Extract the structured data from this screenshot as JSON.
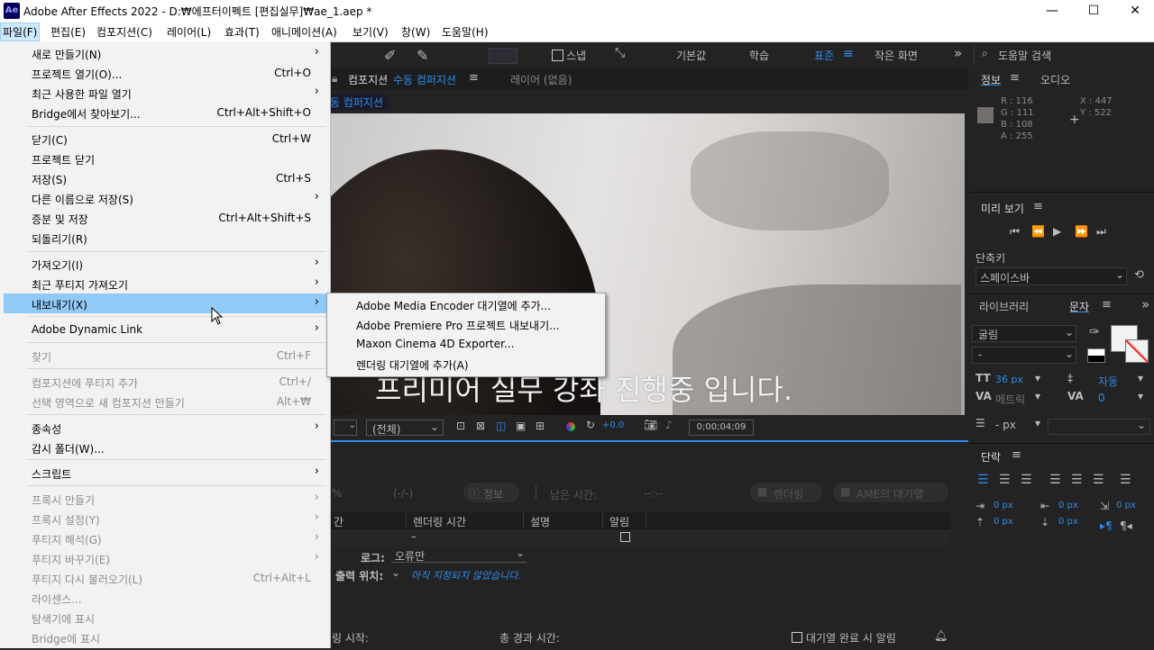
{
  "window": {
    "app_icon": "Ae",
    "title": "Adobe After Effects 2022 - D:₩에프터이펙트 [편집실무]₩ae_1.aep *",
    "minimize": "—",
    "maximize": "☐",
    "close": "✕"
  },
  "menubar": [
    "파일(F)",
    "편집(E)",
    "컴포지션(C)",
    "레이어(L)",
    "효과(T)",
    "애니메이션(A)",
    "보기(V)",
    "창(W)",
    "도움말(H)"
  ],
  "toolbar": {
    "snap": "스냅",
    "workspaces": [
      "기본값",
      "학습",
      "표준",
      "작은 화면"
    ],
    "workspace_menu": "≡",
    "overflow": "»",
    "help_search_placeholder": "도움말 검색"
  },
  "comp_panel": {
    "tab_label": "컴포지션",
    "tab_name": "수동 컴퍼지션",
    "tab_menu": "≡",
    "layer_tab": "레이어 (없음)",
    "breadcrumb": "동 컴퍼지션",
    "subtitle": "프리미어 실무 강좌 진행중 입니다.",
    "view_select": "(전체)",
    "exposure": "+0.0",
    "timecode": "0;00;04;09"
  },
  "render_queue": {
    "percent": "%",
    "progress_time": "(-/-)",
    "info_button": "정보",
    "remaining_label": "남은 시간:",
    "remaining_value": "--:--",
    "render_button": "렌더링",
    "ame_button": "AME의 대기열",
    "columns": [
      "간",
      "렌더링 시간",
      "설명",
      "알림"
    ],
    "row_dash": "–",
    "log_label": "로그:",
    "log_value": "오류만",
    "output_label": "출력 위치:",
    "output_value": "아직 지정되지 않았습니다.",
    "render_start": "링 시작:",
    "total_elapsed": "총 경과 시간:",
    "notify_done": "대기열 완료 시 알림"
  },
  "info_panel": {
    "tab_info": "정보",
    "tab_audio": "오디오",
    "r": "R : 116",
    "g": "G : 111",
    "b": "B : 108",
    "a": "A : 255",
    "x": "X : 447",
    "y": "Y : 522",
    "sample_color": "#746f6c"
  },
  "preview_panel": {
    "title": "미리 보기",
    "menu": "≡",
    "shortcut_label": "단축키",
    "shortcut_value": "스페이스바"
  },
  "char_panel": {
    "tab_library": "라이브러리",
    "tab_character": "문자",
    "font": "굴림",
    "style": "-",
    "size": "36 px",
    "leading": "자동",
    "kerning": "메트릭",
    "tracking": "0",
    "stroke_px": "- px"
  },
  "para_panel": {
    "title": "단락",
    "indent_left": "0 px",
    "indent_right": "0 px",
    "indent_first": "0 px",
    "space_before": "0 px",
    "space_after": "0 px"
  },
  "file_menu": {
    "items": [
      {
        "label": "새로 만들기(N)",
        "shortcut": "",
        "sub": true,
        "disabled": false
      },
      {
        "label": "프로젝트 열기(O)...",
        "shortcut": "Ctrl+O",
        "sub": false,
        "disabled": false
      },
      {
        "label": "최근 사용한 파일 열기",
        "shortcut": "",
        "sub": true,
        "disabled": false
      },
      {
        "label": "Bridge에서 찾아보기...",
        "shortcut": "Ctrl+Alt+Shift+O",
        "sub": false,
        "disabled": false
      },
      {
        "label": "닫기(C)",
        "shortcut": "Ctrl+W",
        "sub": false,
        "disabled": false
      },
      {
        "label": "프로젝트 닫기",
        "shortcut": "",
        "sub": false,
        "disabled": false
      },
      {
        "label": "저장(S)",
        "shortcut": "Ctrl+S",
        "sub": false,
        "disabled": false
      },
      {
        "label": "다른 이름으로 저장(S)",
        "shortcut": "",
        "sub": true,
        "disabled": false
      },
      {
        "label": "증분 및 저장",
        "shortcut": "Ctrl+Alt+Shift+S",
        "sub": false,
        "disabled": false
      },
      {
        "label": "되돌리기(R)",
        "shortcut": "",
        "sub": false,
        "disabled": false
      },
      {
        "label": "가져오기(I)",
        "shortcut": "",
        "sub": true,
        "disabled": false
      },
      {
        "label": "최근 푸티지 가져오기",
        "shortcut": "",
        "sub": true,
        "disabled": false
      },
      {
        "label": "내보내기(X)",
        "shortcut": "",
        "sub": true,
        "disabled": false
      },
      {
        "label": "Adobe Dynamic Link",
        "shortcut": "",
        "sub": true,
        "disabled": false
      },
      {
        "label": "찾기",
        "shortcut": "Ctrl+F",
        "sub": false,
        "disabled": true
      },
      {
        "label": "컴포지션에 푸티지 추가",
        "shortcut": "Ctrl+/",
        "sub": false,
        "disabled": true
      },
      {
        "label": "선택 영역으로 새 컴포지션 만들기",
        "shortcut": "Alt+₩",
        "sub": false,
        "disabled": true
      },
      {
        "label": "종속성",
        "shortcut": "",
        "sub": true,
        "disabled": false
      },
      {
        "label": "감시 폴더(W)...",
        "shortcut": "",
        "sub": false,
        "disabled": false
      },
      {
        "label": "스크립트",
        "shortcut": "",
        "sub": true,
        "disabled": false
      },
      {
        "label": "프록시 만들기",
        "shortcut": "",
        "sub": true,
        "disabled": true
      },
      {
        "label": "프록시 설정(Y)",
        "shortcut": "",
        "sub": true,
        "disabled": true
      },
      {
        "label": "푸티지 해석(G)",
        "shortcut": "",
        "sub": true,
        "disabled": true
      },
      {
        "label": "푸티지 바꾸기(E)",
        "shortcut": "",
        "sub": true,
        "disabled": true
      },
      {
        "label": "푸티지 다시 불러오기(L)",
        "shortcut": "Ctrl+Alt+L",
        "sub": false,
        "disabled": true
      },
      {
        "label": "라이센스...",
        "shortcut": "",
        "sub": false,
        "disabled": true
      },
      {
        "label": "탐색기에 표시",
        "shortcut": "",
        "sub": false,
        "disabled": true
      },
      {
        "label": "Bridge에 표시",
        "shortcut": "",
        "sub": false,
        "disabled": true
      }
    ]
  },
  "export_submenu": [
    "Adobe Media Encoder 대기열에 추가...",
    "Adobe Premiere Pro 프로젝트 내보내기...",
    "Maxon Cinema 4D Exporter...",
    "렌더링 대기열에 추가(A)"
  ],
  "arrow_glyph": "›"
}
